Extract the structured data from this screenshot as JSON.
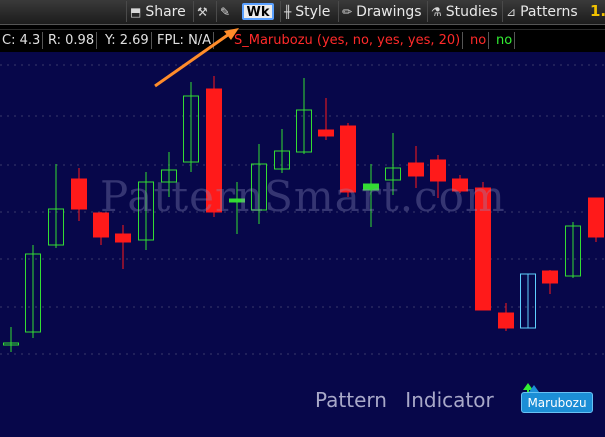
{
  "toolbar": {
    "share_label": "Share",
    "wk_label": "Wk",
    "style_label": "Style",
    "drawings_label": "Drawings",
    "studies_label": "Studies",
    "patterns_label": "Patterns",
    "price_partial": "1."
  },
  "infobar": {
    "c_value": "C: 4.3",
    "r_value": "R: 0.98",
    "y_value": "Y: 2.69",
    "fpl_value": "FPL: N/A",
    "study_label": "S_Marubozu (yes, no, yes, yes, 20)",
    "flag_no": "no",
    "flag_no_green": "no"
  },
  "chart": {
    "watermark": "PatternSmart.com",
    "pattern_label": "Pattern  Indicator",
    "badge_label": "Marubozu",
    "colors": {
      "background": "#07074a",
      "grid": "#3a3a6a",
      "up": "#33dd33",
      "down": "#ff1a1a",
      "highlight": "#5fd0ff",
      "arrow_pointer": "#ff8c2a"
    }
  }
}
